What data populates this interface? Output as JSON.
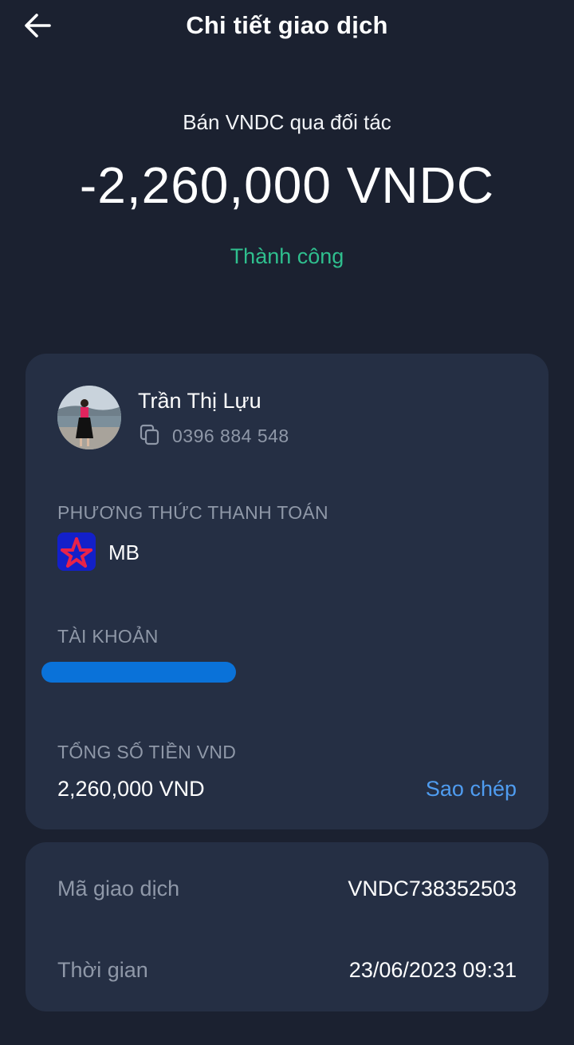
{
  "header": {
    "title": "Chi tiết giao dịch"
  },
  "summary": {
    "type": "Bán VNDC qua đối tác",
    "amount": "-2,260,000 VNDC",
    "status": "Thành công"
  },
  "recipient": {
    "name": "Trần Thị Lựu",
    "phone": "0396 884 548"
  },
  "payment": {
    "method_label": "PHƯƠNG THỨC THANH TOÁN",
    "bank": "MB",
    "account_label": "TÀI KHOẢN",
    "total_label": "TỔNG SỐ TIỀN VND",
    "total_value": "2,260,000 VND",
    "copy_label": "Sao chép"
  },
  "meta": {
    "tx_id_label": "Mã giao dịch",
    "tx_id": "VNDC738352503",
    "time_label": "Thời gian",
    "time": "23/06/2023 09:31"
  },
  "colors": {
    "background": "#1b2130",
    "card": "#252f44",
    "success": "#2fbf8e",
    "link": "#4f9cf0",
    "muted": "#8f98a8",
    "account_mask": "#0a72d9",
    "bank_logo_bg": "#1320c9"
  },
  "icons": {
    "back": "arrow-left-icon",
    "copy": "copy-icon",
    "bank": "mb-bank-logo"
  }
}
